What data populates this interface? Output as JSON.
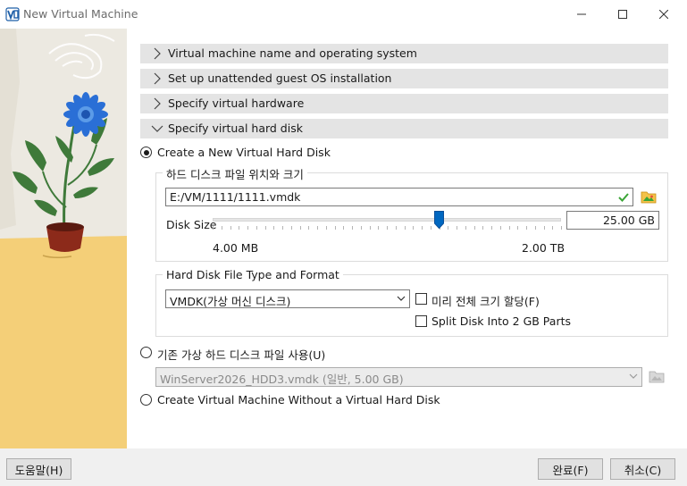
{
  "window": {
    "title": "New Virtual Machine",
    "app_icon": "vmware-workstation-icon",
    "controls": {
      "minimize": "—",
      "maximize": "☐",
      "close": "✕"
    }
  },
  "sections": [
    {
      "label": "Virtual machine name and operating system",
      "expanded": false
    },
    {
      "label": "Set up unattended guest OS installation",
      "expanded": false
    },
    {
      "label": "Specify virtual hardware",
      "expanded": false
    },
    {
      "label": "Specify virtual hard disk",
      "expanded": true
    }
  ],
  "disk": {
    "create_new": {
      "label": "Create a New Virtual Hard Disk",
      "selected": true
    },
    "location_group_title": "하드 디스크 파일 위치와 크기",
    "file_path": "E:/VM/1111/1111.vmdk",
    "valid_icon": "checkmark-icon",
    "browse_icon": "folder-image-icon",
    "size_label": "Disk Size",
    "size_value": "25.00 GB",
    "slider_min": "4.00 MB",
    "slider_max": "2.00 TB",
    "slider_fraction": 0.65,
    "format_group_title": "Hard Disk File Type and Format",
    "format_selected": "VMDK(가상 머신 디스크)",
    "preallocate": {
      "label": "미리 전체 크기 할당(F)",
      "checked": false
    },
    "split": {
      "label": "Split Disk Into 2 GB Parts",
      "checked": false
    },
    "use_existing": {
      "label": "기존 가상 하드 디스크 파일 사용(U)",
      "selected": false
    },
    "existing_selected": "WinServer2026_HDD3.vmdk (일반, 5.00 GB)",
    "no_disk": {
      "label": "Create Virtual Machine Without a Virtual Hard Disk",
      "selected": false
    }
  },
  "buttons": {
    "help": "도움말(H)",
    "finish": "완료(F)",
    "cancel": "취소(C)"
  },
  "colors": {
    "section_bg": "#e4e4e4",
    "accent": "#0067c0",
    "check_green": "#3aa536",
    "illustration_sky": "#ece9e1",
    "illustration_ground": "#f4cf78",
    "flower_blue": "#2a6fd6"
  }
}
